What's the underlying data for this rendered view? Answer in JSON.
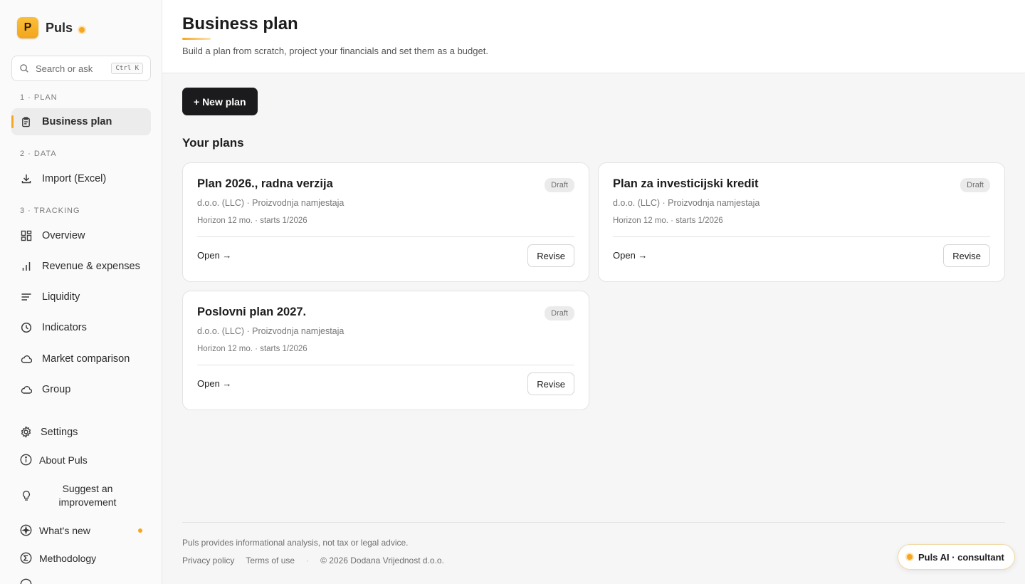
{
  "brand": {
    "logo_letter": "P",
    "name": "Puls"
  },
  "search": {
    "placeholder": "Search or ask",
    "shortcut": "Ctrl K"
  },
  "sidebar": {
    "sections": [
      {
        "label": "1 · PLAN"
      },
      {
        "label": "2 · DATA"
      },
      {
        "label": "3 · TRACKING"
      }
    ],
    "items": [
      {
        "label": "Business plan",
        "icon": "clipboard-icon",
        "active": true
      },
      {
        "label": "Import (Excel)",
        "icon": "download-icon"
      },
      {
        "label": "Overview",
        "icon": "grid-icon"
      },
      {
        "label": "Revenue & expenses",
        "icon": "bar-chart-icon"
      },
      {
        "label": "Liquidity",
        "icon": "lines-icon"
      },
      {
        "label": "Indicators",
        "icon": "clock-icon"
      },
      {
        "label": "Market comparison",
        "icon": "cloud-icon"
      },
      {
        "label": "Group",
        "icon": "cloud-icon"
      }
    ],
    "footer": [
      {
        "label": "Settings",
        "icon": "gear-icon"
      },
      {
        "label": "About Puls",
        "icon": "info-icon"
      },
      {
        "label": "Suggest an improvement",
        "icon": "lightbulb-icon"
      },
      {
        "label": "What's new",
        "icon": "sparkle-icon"
      },
      {
        "label": "Methodology",
        "icon": "sigma-icon"
      }
    ]
  },
  "header": {
    "title": "Business plan",
    "subtitle": "Build a plan from scratch, project your financials and set them as a budget."
  },
  "main": {
    "new_plan_label": "+ New plan",
    "plans_heading": "Your plans",
    "plans": [
      {
        "title": "Plan 2026., radna verzija",
        "badge": "Draft",
        "meta": "d.o.o. (LLC) · Proizvodnja namjestaja",
        "horizon": "Horizon 12 mo. · starts 1/2026",
        "open_label": "Open →",
        "revise_label": "Revise"
      },
      {
        "title": "Plan za investicijski kredit",
        "badge": "Draft",
        "meta": "d.o.o. (LLC) · Proizvodnja namjestaja",
        "horizon": "Horizon 12 mo. · starts 1/2026",
        "open_label": "Open →",
        "revise_label": "Revise"
      },
      {
        "title": "Poslovni plan 2027.",
        "badge": "Draft",
        "meta": "d.o.o. (LLC) · Proizvodnja namjestaja",
        "horizon": "Horizon 12 mo. · starts 1/2026",
        "open_label": "Open →",
        "revise_label": "Revise"
      }
    ]
  },
  "footer": {
    "disclaimer": "Puls provides informational analysis, not tax or legal advice.",
    "privacy": "Privacy policy",
    "terms": "Terms of use",
    "copyright": "© 2026 Dodana Vrijednost d.o.o."
  },
  "assistant": {
    "label": "Puls AI · consultant"
  },
  "colors": {
    "accent": "#f5a623",
    "primary_button": "#1b1b1d",
    "sidebar_bg": "#fafafa",
    "page_bg": "#f6f6f6"
  }
}
